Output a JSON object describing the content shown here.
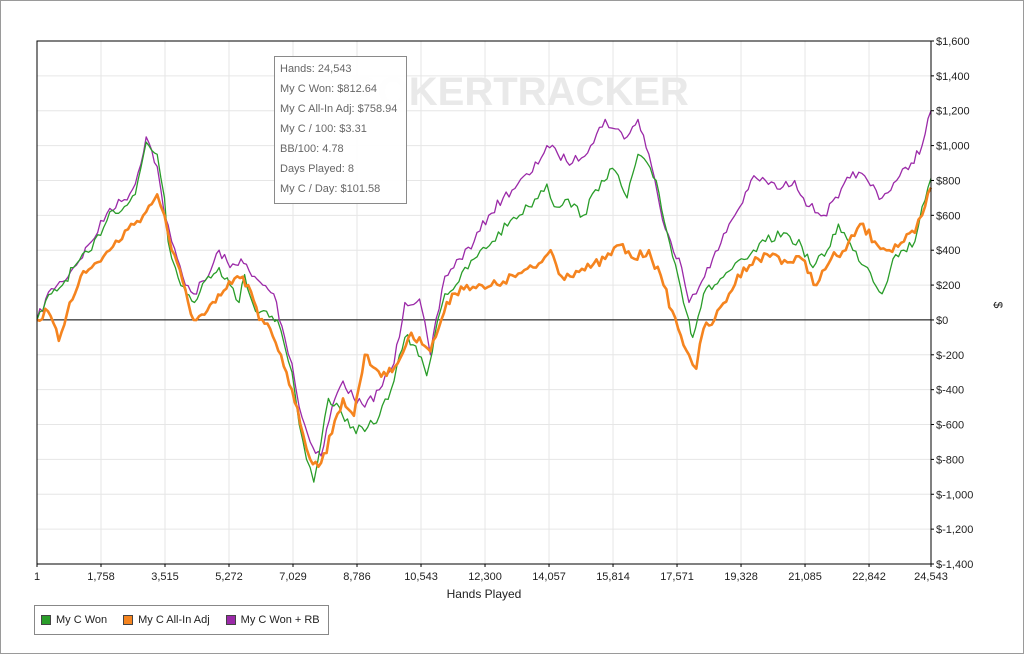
{
  "colors": {
    "won": "#2a9d2a",
    "allin": "#f5841f",
    "rb": "#9b2aa8",
    "grid": "#e6e6e6",
    "axis": "#000000"
  },
  "watermark": "POKERTRACKER",
  "tooltip": {
    "lines": [
      "Hands: 24,543",
      "My C Won: $812.64",
      "My C All-In Adj: $758.94",
      "My C / 100: $3.31",
      "BB/100: 4.78",
      "Days Played: 8",
      "My C / Day: $101.58"
    ]
  },
  "chart_data": {
    "type": "line",
    "title": "",
    "xlabel": "Hands Played",
    "ylabel": "$",
    "xlim": [
      1,
      24543
    ],
    "ylim": [
      -1400,
      1600
    ],
    "x_ticks": [
      1,
      1758,
      3515,
      5272,
      7029,
      8786,
      10543,
      12300,
      14057,
      15814,
      17571,
      19328,
      21085,
      22842,
      24543
    ],
    "x_tick_labels": [
      "1",
      "1,758",
      "3,515",
      "5,272",
      "7,029",
      "8,786",
      "10,543",
      "12,300",
      "14,057",
      "15,814",
      "17,571",
      "19,328",
      "21,085",
      "22,842",
      "24,543"
    ],
    "y_ticks": [
      1600,
      1400,
      1200,
      1000,
      800,
      600,
      400,
      200,
      0,
      -200,
      -400,
      -600,
      -800,
      -1000,
      -1200,
      -1400
    ],
    "y_tick_labels": [
      "$1,600",
      "$1,400",
      "$1,200",
      "$1,000",
      "$800",
      "$600",
      "$400",
      "$200",
      "$0",
      "$-200",
      "$-400",
      "$-600",
      "$-800",
      "$-1,000",
      "$-1,200",
      "$-1,400"
    ],
    "grid": true,
    "legend_position": "bottom-left",
    "series": [
      {
        "name": "My C Won",
        "x": [
          1,
          400,
          700,
          1000,
          1500,
          2000,
          2400,
          2700,
          3000,
          3300,
          3500,
          3600,
          3800,
          4100,
          4400,
          4700,
          5000,
          5300,
          5550,
          5700,
          6000,
          6300,
          6600,
          6800,
          7000,
          7200,
          7400,
          7600,
          7800,
          8000,
          8300,
          8600,
          9000,
          9400,
          9800,
          10100,
          10400,
          10700,
          11000,
          11200,
          11500,
          12000,
          12500,
          13000,
          13500,
          14000,
          14200,
          14500,
          15000,
          15500,
          15800,
          16200,
          16500,
          17000,
          17300,
          17600,
          17900,
          18000,
          18300,
          18600,
          19000,
          19500,
          20000,
          20500,
          21000,
          21300,
          21700,
          22000,
          22400,
          22800,
          23200,
          23500,
          23800,
          24100,
          24300,
          24543
        ],
        "values": [
          0,
          150,
          200,
          300,
          400,
          620,
          650,
          720,
          1020,
          950,
          700,
          450,
          300,
          150,
          120,
          250,
          300,
          200,
          100,
          260,
          50,
          50,
          0,
          -150,
          -300,
          -600,
          -800,
          -930,
          -700,
          -450,
          -500,
          -620,
          -640,
          -550,
          -350,
          -100,
          -150,
          -320,
          0,
          150,
          200,
          350,
          450,
          570,
          650,
          780,
          650,
          690,
          600,
          800,
          870,
          700,
          950,
          800,
          500,
          250,
          0,
          -100,
          150,
          200,
          280,
          350,
          450,
          500,
          420,
          300,
          400,
          550,
          400,
          300,
          150,
          350,
          400,
          450,
          650,
          812.64
        ]
      },
      {
        "name": "My C All-In Adj",
        "x": [
          1,
          300,
          600,
          900,
          1200,
          1500,
          2000,
          2500,
          3000,
          3300,
          3500,
          3700,
          4000,
          4300,
          4600,
          4900,
          5200,
          5500,
          5800,
          6100,
          6400,
          6700,
          7000,
          7300,
          7500,
          7800,
          8100,
          8400,
          8700,
          9000,
          9300,
          9600,
          9900,
          10200,
          10500,
          10800,
          11100,
          11400,
          11800,
          12300,
          12800,
          13300,
          13700,
          14100,
          14400,
          14800,
          15200,
          15600,
          16000,
          16400,
          16800,
          17200,
          17600,
          17900,
          18100,
          18300,
          18600,
          19000,
          19400,
          19800,
          20200,
          20600,
          21000,
          21400,
          21800,
          22200,
          22600,
          23000,
          23400,
          23800,
          24100,
          24300,
          24543
        ],
        "values": [
          0,
          50,
          -120,
          100,
          250,
          300,
          400,
          520,
          620,
          720,
          600,
          400,
          220,
          0,
          30,
          100,
          180,
          250,
          200,
          0,
          -50,
          -200,
          -400,
          -650,
          -800,
          -820,
          -650,
          -450,
          -550,
          -200,
          -280,
          -320,
          -250,
          -100,
          -100,
          -180,
          0,
          150,
          200,
          180,
          220,
          270,
          300,
          400,
          250,
          280,
          300,
          350,
          430,
          350,
          400,
          200,
          -50,
          -200,
          -280,
          -50,
          0,
          150,
          300,
          350,
          380,
          330,
          350,
          200,
          350,
          400,
          550,
          450,
          400,
          450,
          500,
          600,
          758.94
        ]
      },
      {
        "name": "My C Won + RB",
        "x": [
          1,
          400,
          700,
          1000,
          1500,
          2000,
          2400,
          2700,
          3000,
          3300,
          3500,
          3700,
          4000,
          4300,
          4700,
          5000,
          5300,
          5600,
          5900,
          6200,
          6500,
          6800,
          7000,
          7200,
          7500,
          7800,
          8100,
          8400,
          8700,
          9000,
          9400,
          9800,
          10100,
          10500,
          10800,
          11200,
          11600,
          12000,
          12400,
          12800,
          13200,
          13600,
          14000,
          14300,
          14700,
          15200,
          15600,
          15800,
          16200,
          16500,
          16800,
          17100,
          17400,
          17700,
          17900,
          18100,
          18400,
          18700,
          19000,
          19300,
          19600,
          20000,
          20400,
          20800,
          21200,
          21600,
          22000,
          22400,
          22800,
          23200,
          23600,
          24000,
          24300,
          24543
        ],
        "values": [
          0,
          180,
          220,
          300,
          450,
          640,
          690,
          780,
          1050,
          880,
          600,
          450,
          250,
          150,
          250,
          400,
          300,
          350,
          250,
          200,
          150,
          -100,
          -250,
          -500,
          -700,
          -780,
          -500,
          -350,
          -450,
          -500,
          -400,
          -250,
          100,
          120,
          -200,
          250,
          350,
          450,
          600,
          700,
          780,
          850,
          1000,
          950,
          900,
          1000,
          1150,
          1100,
          1050,
          1150,
          950,
          650,
          450,
          300,
          100,
          150,
          300,
          400,
          550,
          650,
          800,
          800,
          750,
          800,
          650,
          600,
          700,
          850,
          800,
          700,
          800,
          900,
          1000,
          1200
        ]
      }
    ]
  },
  "legend": [
    {
      "label": "My C Won",
      "key": "won"
    },
    {
      "label": "My C All-In Adj",
      "key": "allin"
    },
    {
      "label": "My C Won + RB",
      "key": "rb"
    }
  ]
}
